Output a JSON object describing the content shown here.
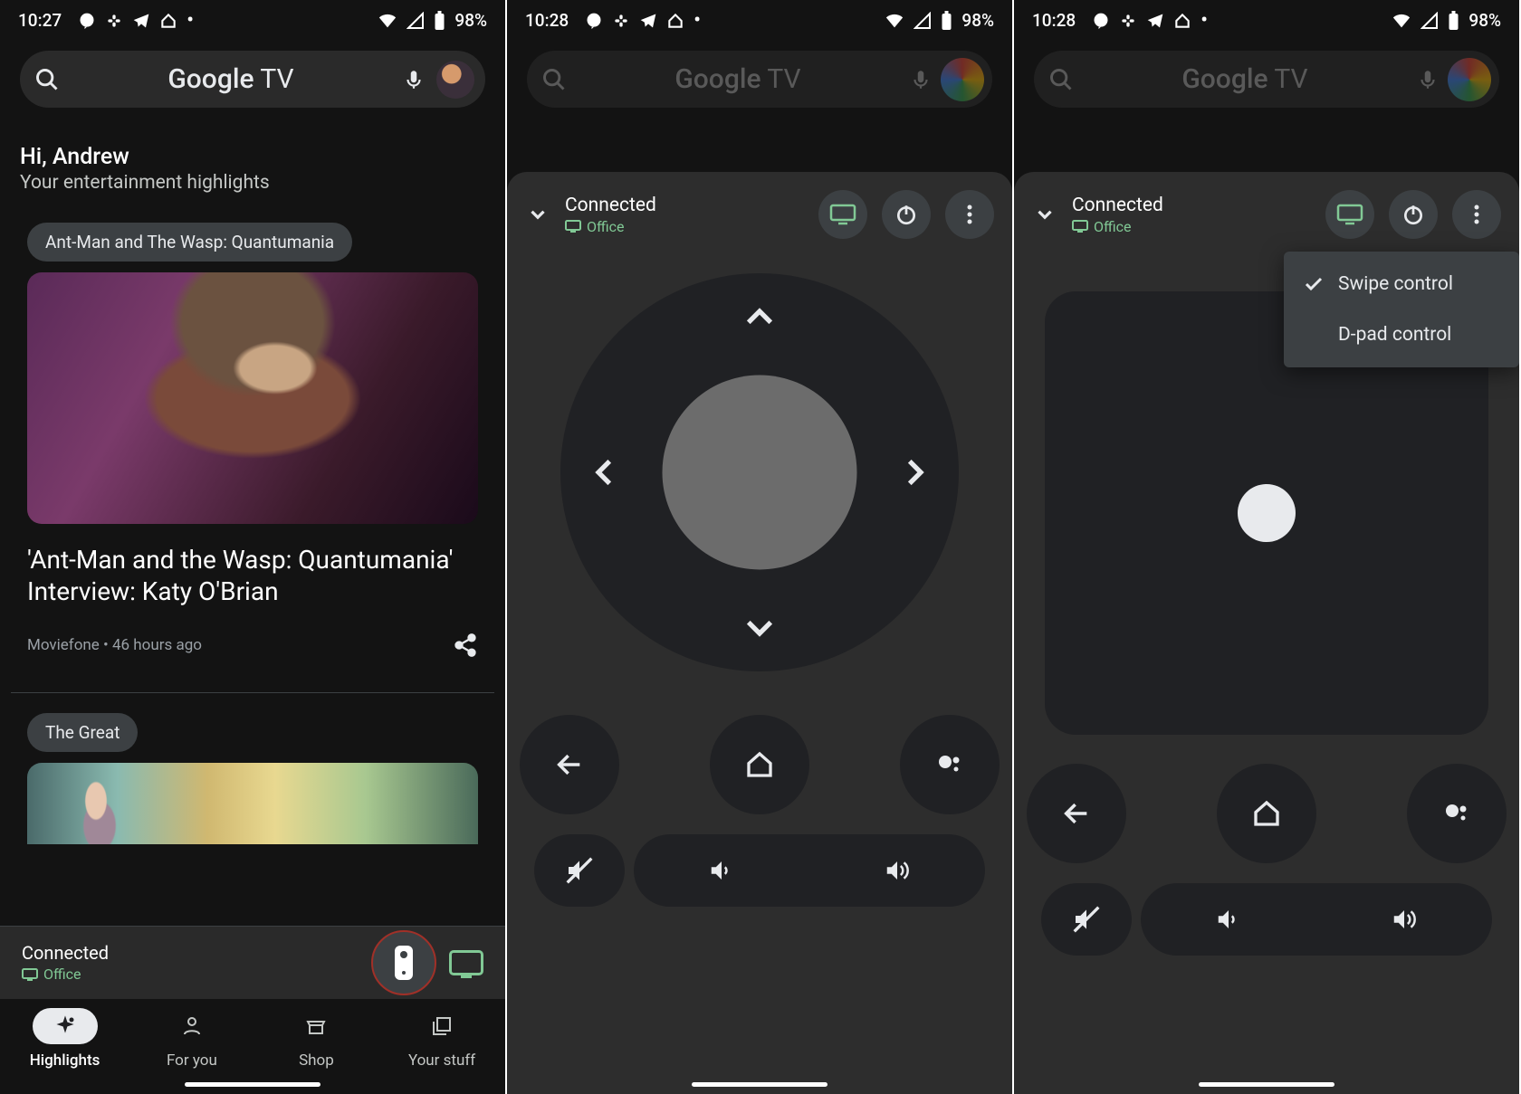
{
  "status": {
    "time1": "10:27",
    "time2": "10:28",
    "battery": "98%"
  },
  "search": {
    "brand_main": "Google",
    "brand_suffix": " TV"
  },
  "greeting": {
    "hi": "Hi, Andrew",
    "sub": "Your entertainment highlights"
  },
  "chip1": "Ant-Man and The Wasp: Quantumania",
  "card1": {
    "title": "'Ant-Man and the Wasp: Quantumania' Interview: Katy O'Brian",
    "source": "Moviefone",
    "sep": " • ",
    "time": "46 hours ago"
  },
  "chip2": "The Great",
  "connected": {
    "title": "Connected",
    "device": "Office"
  },
  "nav": {
    "highlights": "Highlights",
    "foryou": "For you",
    "shop": "Shop",
    "yourstuff": "Your stuff"
  },
  "menu": {
    "swipe": "Swipe control",
    "dpad": "D-pad control"
  },
  "hi_partial": "Hi A"
}
